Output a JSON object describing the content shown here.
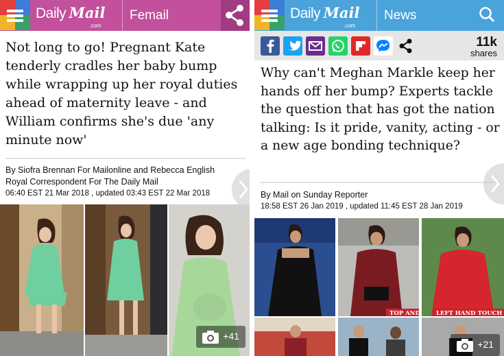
{
  "left": {
    "brand": {
      "daily": "Daily",
      "mail": "Mail",
      "com": ".com"
    },
    "section": "Femail",
    "colors": {
      "header": "#c2509c",
      "share_box": "#a13b82"
    },
    "headline": "Not long to go! Pregnant Kate tenderly cradles her baby bump while wrapping up her royal duties ahead of maternity leave - and William confirms she's due 'any minute now'",
    "byline": {
      "authors": "By Siofra Brennan For Mailonline and Rebecca English",
      "role": "Royal Correspondent For The Daily Mail",
      "timestamp": "06:40 EST 21 Mar 2018 , updated 03:43 EST 22 Mar 2018"
    },
    "gallery_count": "+41"
  },
  "right": {
    "brand": {
      "daily": "Daily",
      "mail": "Mail",
      "com": ".com"
    },
    "section": "News",
    "colors": {
      "header": "#4aa3db"
    },
    "share_icons": [
      "facebook-icon",
      "twitter-icon",
      "email-icon",
      "whatsapp-icon",
      "flipboard-icon",
      "messenger-icon",
      "share-icon"
    ],
    "shares": {
      "count": "11k",
      "label": "shares"
    },
    "headline": "Why can't Meghan Markle keep her hands off her bump? Experts tackle the question that has got the nation talking: Is it pride, vanity, acting - or a new age bonding technique?",
    "byline": {
      "authors": "By Mail on Sunday Reporter",
      "timestamp": "18:58 EST 26 Jan 2019 , updated 11:45 EST 28 Jan 2019"
    },
    "captions": {
      "a": "TOP AND TOE HOLD",
      "b": "LEFT HAND TOUCH"
    },
    "gallery_count": "+21"
  }
}
